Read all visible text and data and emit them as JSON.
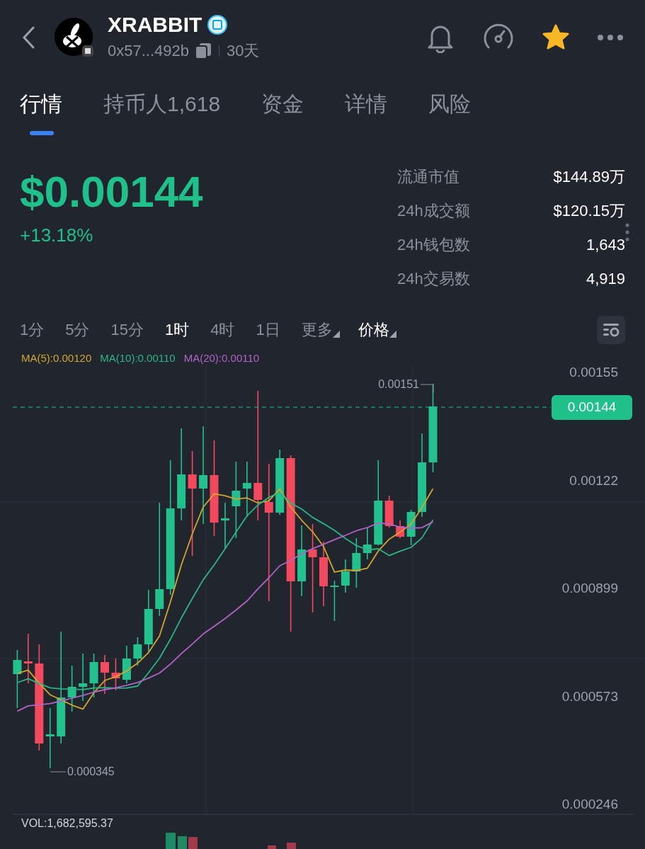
{
  "header": {
    "title": "XRABBIT",
    "address": "0x57...492b",
    "age": "30天",
    "favorited": true
  },
  "tabs": [
    {
      "label": "行情",
      "selected": true
    },
    {
      "label": "持币人1,618",
      "selected": false
    },
    {
      "label": "资金",
      "selected": false
    },
    {
      "label": "详情",
      "selected": false
    },
    {
      "label": "风险",
      "selected": false
    }
  ],
  "price": "$0.00144",
  "change": "+13.18%",
  "stats": [
    {
      "label": "流通市值",
      "value": "$144.89万"
    },
    {
      "label": "24h成交额",
      "value": "$120.15万"
    },
    {
      "label": "24h钱包数",
      "value": "1,643"
    },
    {
      "label": "24h交易数",
      "value": "4,919"
    }
  ],
  "timeframes": [
    {
      "label": "1分",
      "selected": false,
      "kind": "option"
    },
    {
      "label": "5分",
      "selected": false,
      "kind": "option"
    },
    {
      "label": "15分",
      "selected": false,
      "kind": "option"
    },
    {
      "label": "1时",
      "selected": true,
      "kind": "option"
    },
    {
      "label": "4时",
      "selected": false,
      "kind": "option"
    },
    {
      "label": "1日",
      "selected": false,
      "kind": "option"
    },
    {
      "label": "更多",
      "selected": false,
      "kind": "dropdown"
    },
    {
      "label": "价格",
      "selected": true,
      "kind": "dropdown"
    }
  ],
  "ma_legend": [
    {
      "label": "MA(5):0.00120",
      "color": "#d1a62e"
    },
    {
      "label": "MA(10):0.00110",
      "color": "#2bb584"
    },
    {
      "label": "MA(20):0.00110",
      "color": "#b263c7"
    }
  ],
  "chart": {
    "price_axis": [
      "0.00155",
      "0.00122",
      "0.000899",
      "0.000573",
      "0.000246"
    ],
    "high_marker": "0.00151",
    "low_marker": "0.000345",
    "current_price": "0.00144",
    "volume": "VOL:1,682,595.37"
  }
}
